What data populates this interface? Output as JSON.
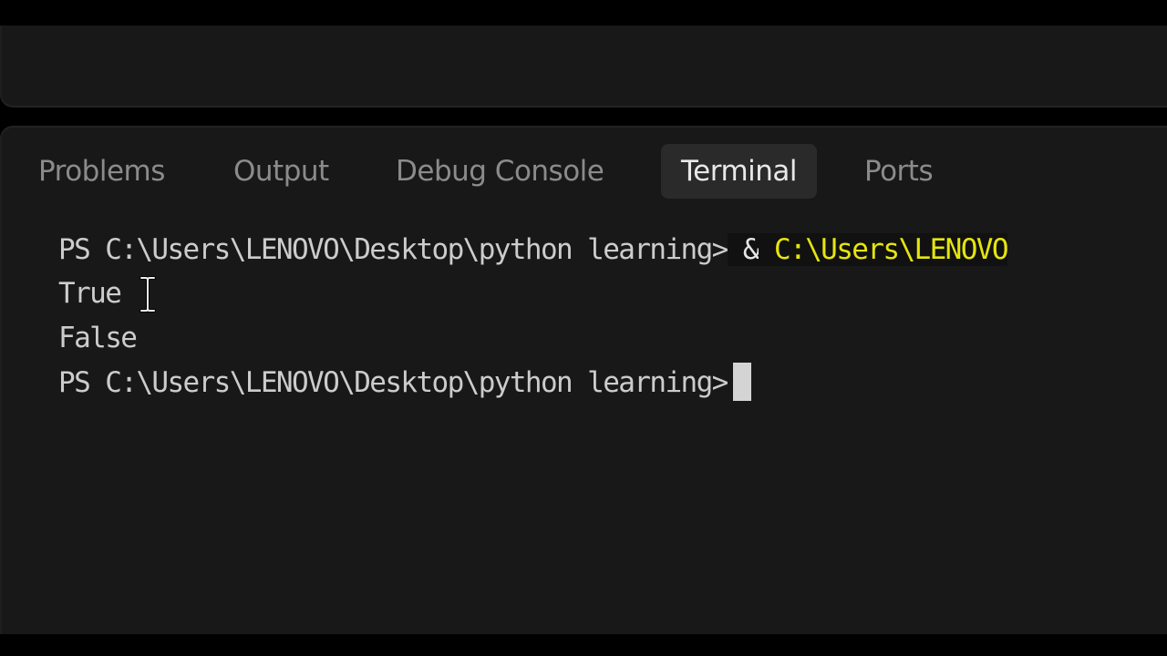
{
  "panel": {
    "tabs": [
      {
        "label": "Problems",
        "active": false
      },
      {
        "label": "Output",
        "active": false
      },
      {
        "label": "Debug Console",
        "active": false
      },
      {
        "label": "Terminal",
        "active": true
      },
      {
        "label": "Ports",
        "active": false
      }
    ]
  },
  "terminal": {
    "lines": [
      {
        "prompt": "PS C:\\Users\\LENOVO\\Desktop\\python learning>",
        "operator": "&",
        "command": "C:\\Users\\LENOVO"
      },
      {
        "text": "True"
      },
      {
        "text": "False"
      },
      {
        "prompt": "PS C:\\Users\\LENOVO\\Desktop\\python learning>"
      }
    ]
  },
  "colors": {
    "background": "#181818",
    "active_tab_bg": "#2a2a2a",
    "command_path": "#e5e510",
    "text": "#cccccc"
  },
  "icons": {
    "text_cursor": "i-beam-cursor-icon",
    "terminal_cursor": "block-cursor"
  }
}
